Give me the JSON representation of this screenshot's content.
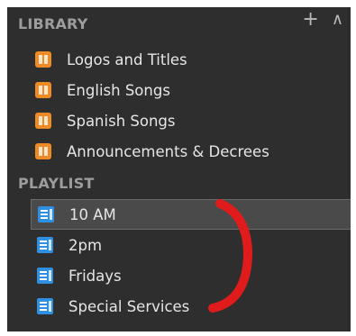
{
  "library": {
    "title": "LIBRARY",
    "tools": {
      "add_icon": "plus-icon",
      "collapse_icon": "chevron-up-icon"
    },
    "items": [
      {
        "label": "Logos and Titles",
        "icon": "library-icon"
      },
      {
        "label": "English Songs",
        "icon": "library-icon"
      },
      {
        "label": "Spanish Songs",
        "icon": "library-icon"
      },
      {
        "label": "Announcements & Decrees",
        "icon": "library-icon"
      }
    ]
  },
  "playlist": {
    "title": "PLAYLIST",
    "items": [
      {
        "label": "10 AM",
        "icon": "playlist-icon",
        "selected": true
      },
      {
        "label": "2pm",
        "icon": "playlist-icon",
        "selected": false
      },
      {
        "label": "Fridays",
        "icon": "playlist-icon",
        "selected": false
      },
      {
        "label": "Special Services",
        "icon": "playlist-icon",
        "selected": false
      }
    ]
  },
  "colors": {
    "background": "#2e2e2e",
    "header_text": "#9d9d9d",
    "item_text": "#e6e6e6",
    "library_icon": "#f08a24",
    "playlist_icon": "#2f8fe0",
    "selection": "#4a4a4a",
    "annotation": "#e01b1b"
  }
}
